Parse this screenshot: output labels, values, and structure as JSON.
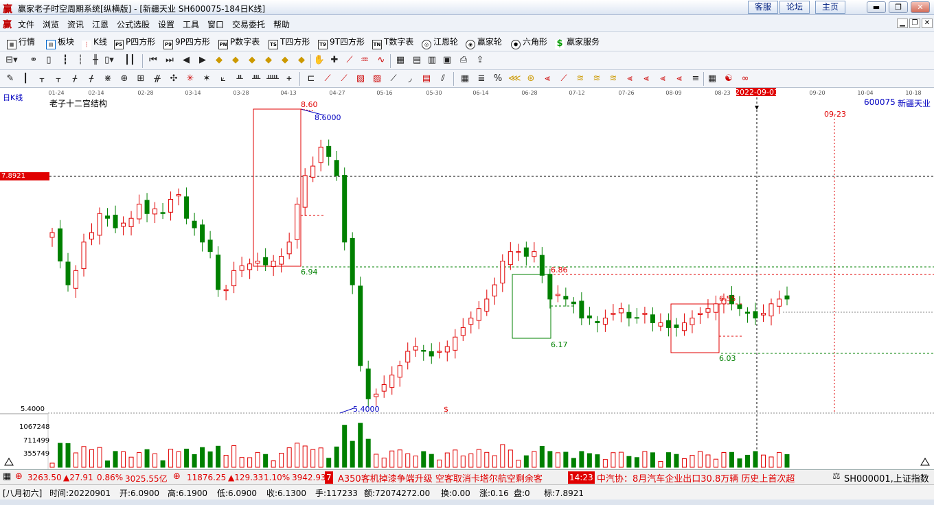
{
  "window": {
    "logo": "赢",
    "title": "赢家老子时空周期系统[纵横版] - [新疆天业  SH600075-184日K线]",
    "buttons": [
      "客服",
      "论坛",
      "主页"
    ]
  },
  "menu": [
    "文件",
    "浏览",
    "资讯",
    "江恩",
    "公式选股",
    "设置",
    "工具",
    "窗口",
    "交易委托",
    "帮助"
  ],
  "toolbar1": [
    {
      "label": "行情",
      "icon": "grid-icon"
    },
    {
      "label": "板块",
      "icon": "blocks-icon"
    },
    {
      "label": "K线",
      "icon": "candlestick-icon"
    },
    {
      "label": "P四方形",
      "icon": "P5"
    },
    {
      "label": "9P四方形",
      "icon": "P9"
    },
    {
      "label": "P数字表",
      "icon": "PN"
    },
    {
      "label": "T四方形",
      "icon": "TS"
    },
    {
      "label": "9T四方形",
      "icon": "T9"
    },
    {
      "label": "T数字表",
      "icon": "TN"
    },
    {
      "label": "江恩轮",
      "icon": "wheel-icon"
    },
    {
      "label": "赢家轮",
      "icon": "winner-wheel-icon"
    },
    {
      "label": "六角形",
      "icon": "hexagon-icon"
    },
    {
      "label": "赢家服务",
      "icon": "dollar-icon"
    }
  ],
  "chart": {
    "period_label": "日K线",
    "indicator_name": "老子十二宫结构",
    "stock_code": "600075",
    "stock_name": "新疆天业",
    "date_ticks": [
      "01-24",
      "02-14",
      "02-28",
      "03-14",
      "03-28",
      "04-13",
      "04-27",
      "05-16",
      "05-30",
      "06-14",
      "06-28",
      "07-12",
      "07-26",
      "08-09",
      "08-23",
      "2022-09-01",
      "09-20",
      "10-04",
      "10-18"
    ],
    "cursor_date": "2022-09-01",
    "price_tag": "7.8921",
    "low_axis_price": "5.4000",
    "volume_ticks": [
      "1067248",
      "711499",
      "355749"
    ],
    "annotations": {
      "high_red": "8.60",
      "high_blue": "8.6000",
      "level_694": "6.94",
      "level_686": "6.86",
      "level_617": "6.17",
      "level_655": "6.55",
      "level_603": "6.03",
      "low_blue": "5.4000",
      "future_date": "09-23",
      "dollar_mark": "$"
    }
  },
  "status": {
    "index1": {
      "value": "3263.50",
      "change": "▲27.91",
      "pct": "0.86%",
      "amount": "3025.55亿"
    },
    "index2": {
      "value": "11876.25",
      "change": "▲129.33",
      "pct": "1.10%",
      "amount": "3942.93"
    },
    "news_badge": "7",
    "news1": "A350客机掉漆争端升级 空客取消卡塔尔航空剩余客",
    "news_time": "14:23",
    "news2": "中汽协：8月汽车企业出口30.8万辆 历史上首次超",
    "index_ticker": "SH000001,上证指数"
  },
  "quote": {
    "lunar": "[八月初六]",
    "date": "时间:20220901",
    "open": "开:6.0900",
    "high": "高:6.1900",
    "low": "低:6.0900",
    "close": "收:6.1300",
    "volume": "手:117233",
    "amount": "额:72074272.00",
    "turnover": "换:0.00",
    "change": "涨:0.16",
    "vol2": "盘:0",
    "mark": "标:7.8921"
  },
  "price_series": [
    7.3,
    7.0,
    6.75,
    6.9,
    7.2,
    7.3,
    7.5,
    7.45,
    7.35,
    7.4,
    7.45,
    7.6,
    7.5,
    7.55,
    7.5,
    7.65,
    7.7,
    7.45,
    7.35,
    7.2,
    7.1,
    6.7,
    6.7,
    6.9,
    6.95,
    6.97,
    7.0,
    6.96,
    7.0,
    7.05,
    7.2,
    7.6,
    7.9,
    8.0,
    8.2,
    8.1,
    7.9,
    7.2,
    6.75,
    5.9,
    5.55,
    5.6,
    5.7,
    5.8,
    5.9,
    6.05,
    6.1,
    6.05,
    6.0,
    6.05,
    6.1,
    6.2,
    6.3,
    6.4,
    6.5,
    6.6,
    6.75,
    7.0,
    7.1,
    7.1,
    7.05,
    7.1,
    6.85,
    6.6,
    6.65,
    6.6,
    6.55,
    6.4,
    6.4,
    6.35,
    6.4,
    6.45,
    6.5,
    6.4,
    6.4,
    6.45,
    6.35,
    6.35,
    6.3,
    6.3,
    6.35,
    6.4,
    6.45,
    6.5,
    6.55,
    6.6,
    6.55,
    6.5,
    6.45,
    6.4,
    6.45,
    6.55,
    6.6,
    6.6
  ]
}
